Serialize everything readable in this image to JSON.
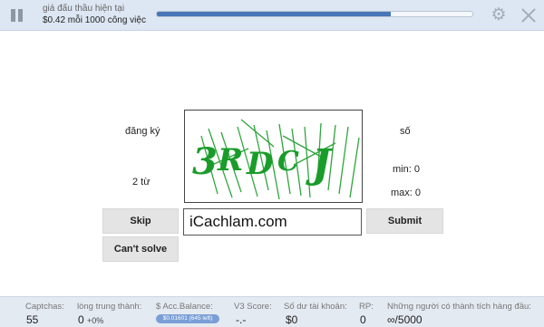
{
  "header": {
    "bid_label": "giá đấu thầu hiện tại",
    "bid_value": "$0.42 mỗi 1000 công việc",
    "progress_percent": 74
  },
  "task": {
    "left_top_label": "đăng ký",
    "left_bottom_label": "2 từ",
    "right_top_label": "số",
    "min_label": "min: 0",
    "max_label": "max: 0",
    "captcha_text": "3RDCJ",
    "answer_value": "iCachlam.com"
  },
  "buttons": {
    "skip": "Skip",
    "cant_solve": "Can't solve",
    "submit": "Submit"
  },
  "footer": {
    "captchas_label": "Captchas:",
    "captchas_value": "55",
    "loyalty_label": "lòng trung thành:",
    "loyalty_value": "0",
    "loyalty_percent": "+0%",
    "balance_label": "$ Acc.Balance:",
    "balance_pill": "$0.01601 (645 left)",
    "v3_label": "V3 Score:",
    "v3_value": "-.-",
    "account_label": "Số dư tài khoản:",
    "account_value": "$0",
    "rp_label": "RP:",
    "rp_value": "0",
    "leaders_label": "Những người có thành tích hàng đầu:",
    "leaders_value": "∞/5000"
  },
  "colors": {
    "captcha_green": "#1a9c2a",
    "progress_fill": "#4a76b8",
    "top_bar": "#dde7f3"
  },
  "icons": [
    "pause-icon",
    "gear-icon",
    "close-icon"
  ]
}
